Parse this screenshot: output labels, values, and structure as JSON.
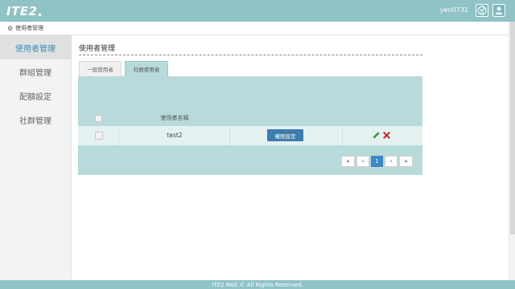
{
  "header": {
    "logo_text": "ITE2",
    "username": "yen0731",
    "icons": [
      "language-icon",
      "user-icon"
    ]
  },
  "breadcrumb": {
    "icon": "gear-icon",
    "label": "使用者管理"
  },
  "sidebar": {
    "items": [
      {
        "label": "使用者管理",
        "active": true
      },
      {
        "label": "群組管理",
        "active": false
      },
      {
        "label": "配額設定",
        "active": false
      },
      {
        "label": "社群管理",
        "active": false
      }
    ]
  },
  "main": {
    "title": "使用者管理",
    "tabs": [
      {
        "label": "一般使用者",
        "active": false
      },
      {
        "label": "社群使用者",
        "active": true
      }
    ],
    "table": {
      "columns": [
        "",
        "使用者名稱",
        "",
        ""
      ],
      "rows": [
        {
          "name": "test2",
          "action_label": "權限設定",
          "icons": [
            "edit-icon",
            "delete-icon"
          ]
        }
      ]
    },
    "pagination": {
      "first": "«",
      "prev": "‹",
      "current": "1",
      "next": "›",
      "last": "»"
    }
  },
  "footer": {
    "text": "ITE2 NAS © All Rights Reserved."
  },
  "colors": {
    "topbar": "#8fc3c6",
    "panel": "#b8dadb",
    "row": "#e3f1f1",
    "accent_button": "#3e7cad",
    "active_page": "#3b88c5",
    "sidebar_active_text": "#3d8bb2"
  }
}
